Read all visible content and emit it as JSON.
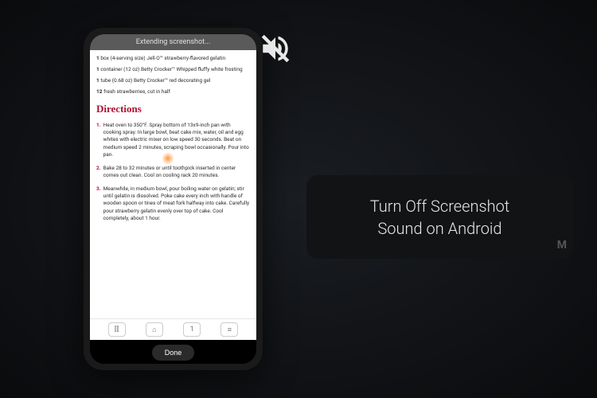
{
  "phone": {
    "topbar_text": "Extending screenshot...",
    "ingredients": [
      {
        "qty": "1",
        "text": "box (4-serving size) Jell-O™ strawberry-flavored gelatin"
      },
      {
        "qty": "1",
        "text": "container (12 oz) Betty Crocker™ Whipped fluffy white frosting"
      },
      {
        "qty": "1",
        "text": "tube (0.68 oz) Betty Crocker™ red decorating gel"
      },
      {
        "qty": "12",
        "text": "fresh strawberries, cut in half"
      }
    ],
    "directions_title": "Directions",
    "steps": [
      {
        "num": "1.",
        "text": "Heat oven to 350°F. Spray bottom of 13x9-inch pan with cooking spray. In large bowl, beat cake mix, water, oil and egg whites with electric mixer on low speed 30 seconds. Beat on medium speed 2 minutes, scraping bowl occasionally. Pour into pan."
      },
      {
        "num": "2.",
        "text": "Bake 28 to 32 minutes or until toothpick inserted in center comes out clean. Cool on cooling rack 20 minutes."
      },
      {
        "num": "3.",
        "text": "Meanwhile, in medium bowl, pour boiling water on gelatin; stir until gelatin is dissolved. Poke cake every inch with handle of wooden spoon or tines of meat fork halfway into cake. Carefully pour strawberry gelatin evenly over top of cake. Cool completely, about 1 hour."
      }
    ],
    "bottombar": {
      "book": "⫿⫿",
      "home": "⌂",
      "page": "1",
      "menu": "≡"
    },
    "done_label": "Done"
  },
  "title_card": {
    "line1": "Turn Off Screenshot",
    "line2": "Sound on Android"
  },
  "watermark": "M"
}
